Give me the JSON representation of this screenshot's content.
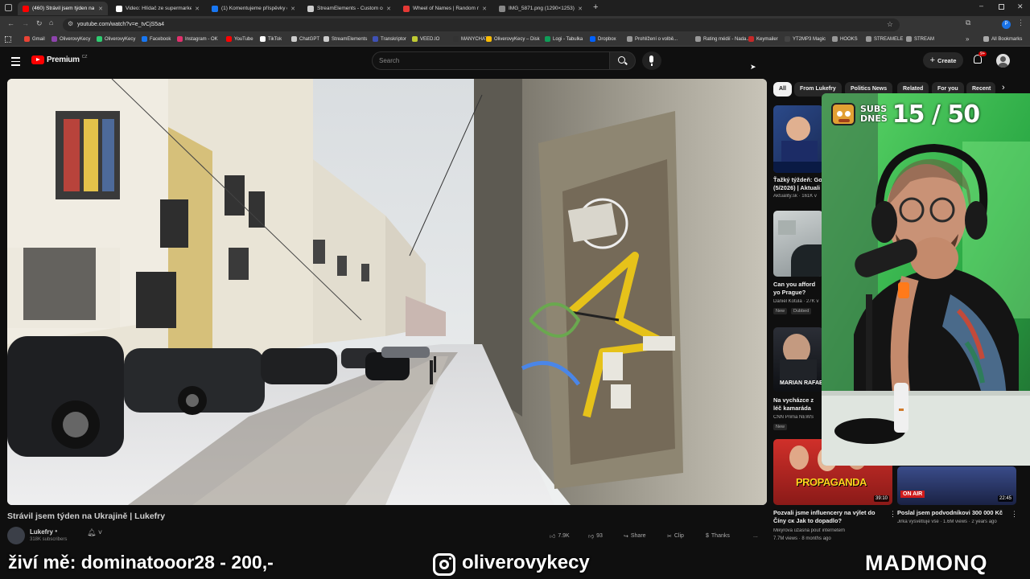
{
  "tabs": [
    {
      "label": "(460) Strávil jsem týden na",
      "active": true,
      "fav_color": "#ff0000"
    },
    {
      "label": "Video: Hlídač ze supermarketu",
      "fav_color": "#ffffff"
    },
    {
      "label": "(1) Komentujeme příspěvky de",
      "fav_color": "#1877f2"
    },
    {
      "label": "StreamElements - Custom com",
      "fav_color": "#cccccc"
    },
    {
      "label": "Wheel of Names | Random nam",
      "fav_color": "#e53935"
    },
    {
      "label": "IMG_5871.png (1290×1253)",
      "fav_color": "#888888"
    }
  ],
  "url": "youtube.com/watch?v=e_tvCjS5a4",
  "bookmarks": [
    {
      "label": "Gmail",
      "color": "#ea4335"
    },
    {
      "label": "OliverovyKecy",
      "color": "#8e44ad"
    },
    {
      "label": "OliverovyKecy",
      "color": "#2ecc71"
    },
    {
      "label": "Facebook",
      "color": "#1877f2"
    },
    {
      "label": "Instagram - OK",
      "color": "#e1306c"
    },
    {
      "label": "YouTube",
      "color": "#ff0000"
    },
    {
      "label": "TikTok",
      "color": "#ffffff"
    },
    {
      "label": "ChatGPT",
      "color": "#cccccc"
    },
    {
      "label": "StreamElements",
      "color": "#cccccc"
    },
    {
      "label": "Transkriptor",
      "color": "#3f51b5"
    },
    {
      "label": "VEED.IO",
      "color": "#c0ca33"
    },
    {
      "label": "MANYCHAT",
      "color": "#333333"
    },
    {
      "label": "OliverovyKecy – Disk",
      "color": "#fbbc04"
    },
    {
      "label": "Logi - Tabulka",
      "color": "#0f9d58"
    },
    {
      "label": "Dropbox",
      "color": "#0061ff"
    },
    {
      "label": "Prohlížení o volbě...",
      "color": "#999999"
    },
    {
      "label": "Rating médií - Nada...",
      "color": "#999999"
    },
    {
      "label": "Keymailer",
      "color": "#c62828"
    },
    {
      "label": "YT2MP3 Magic",
      "color": "#444444"
    },
    {
      "label": "HOOKS",
      "color": "#999999"
    },
    {
      "label": "STREAMELE",
      "color": "#999999"
    },
    {
      "label": "STREAM",
      "color": "#999999"
    }
  ],
  "all_bookmarks": "All Bookmarks",
  "header": {
    "logo_text": "Premium",
    "logo_region": "CZ",
    "search_placeholder": "Search",
    "create_label": "Create",
    "notif_count": "9+"
  },
  "chips": [
    "All",
    "From Lukefry",
    "Politics News",
    "Related",
    "For you",
    "Recent"
  ],
  "recommendations": [
    {
      "title": "Ťažký týždeň: Go (5/2026) | Aktuali",
      "channel": "Aktuality.sk",
      "meta": "161K v"
    },
    {
      "title": "Can you afford yo Prague?",
      "channel": "Daniel Kotula",
      "meta": "27K v",
      "badges": [
        "New",
        "Dubbed"
      ]
    },
    {
      "title": "Na vycházce z léč kamaráda Viléma",
      "channel": "CNN Prima NEWS",
      "badges": [
        "New"
      ],
      "thumb_text": "MARIAN RAFAE"
    },
    {
      "title": "Pozvali jsme influencery na výlet do Číny ᴄᴋ Jak to dopadlo?",
      "channel": "Mikýrova úžasná pouť internetem",
      "meta": "7.7M views · 8 months ago",
      "duration": "39:10",
      "thumb_text": "PROPAGANDA"
    },
    {
      "title": "Poslal jsem podvodníkovi 300 000 Kč",
      "channel": "Jirka vysvětluje vše",
      "meta": "1.6M views · 2 years ago",
      "duration": "22:45",
      "thumb_text": "ON AIR"
    }
  ],
  "overlay": {
    "subs_label_1": "SUBS",
    "subs_label_2": "DNES",
    "subs_count": "15 / 50",
    "donor": "živí mě: dominatooor28 - 200,-",
    "instagram": "oliverovykecy",
    "brand": "MADMONQ"
  },
  "video": {
    "title": "Strávil jsem týden na Ukrajině | Lukefry",
    "channel": "Lukefry",
    "subscribers": "318K subscribers",
    "likes": "7.9K",
    "dislikes": "93",
    "share": "Share",
    "clip": "Clip",
    "thanks": "Thanks",
    "more": "..."
  },
  "colors": {
    "accent": "#ff0000",
    "background": "#0f0f0f",
    "chip_active": "#f1f1f1",
    "overlay_green": "#3ddc4a"
  }
}
